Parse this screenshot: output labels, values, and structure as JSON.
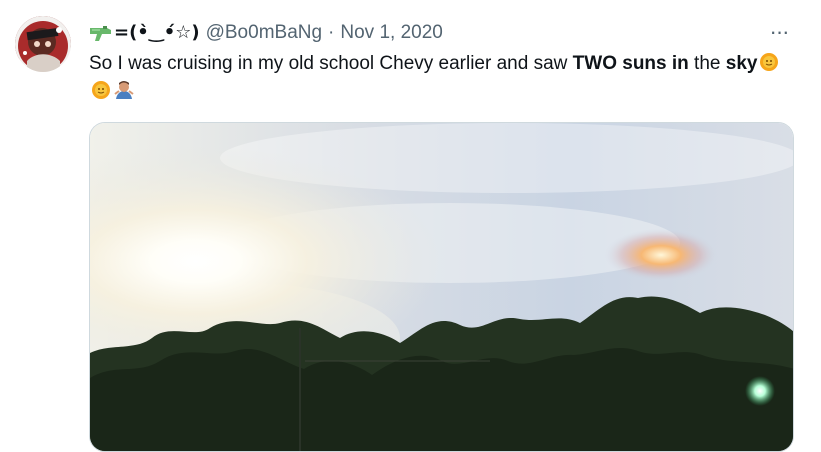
{
  "tweet": {
    "display_name": "=(•̀‿•́☆)",
    "handle": "@Bo0mBaNg",
    "separator": "·",
    "date": "Nov 1, 2020",
    "more": "···",
    "text_part1": "So I was cruising in my old school Chevy earlier and saw ",
    "text_bold": "TWO suns in",
    "text_part2": " the ",
    "text_bold2": "sky",
    "emojis": [
      "sun-with-face",
      "sun-with-face",
      "man-shrugging"
    ]
  }
}
